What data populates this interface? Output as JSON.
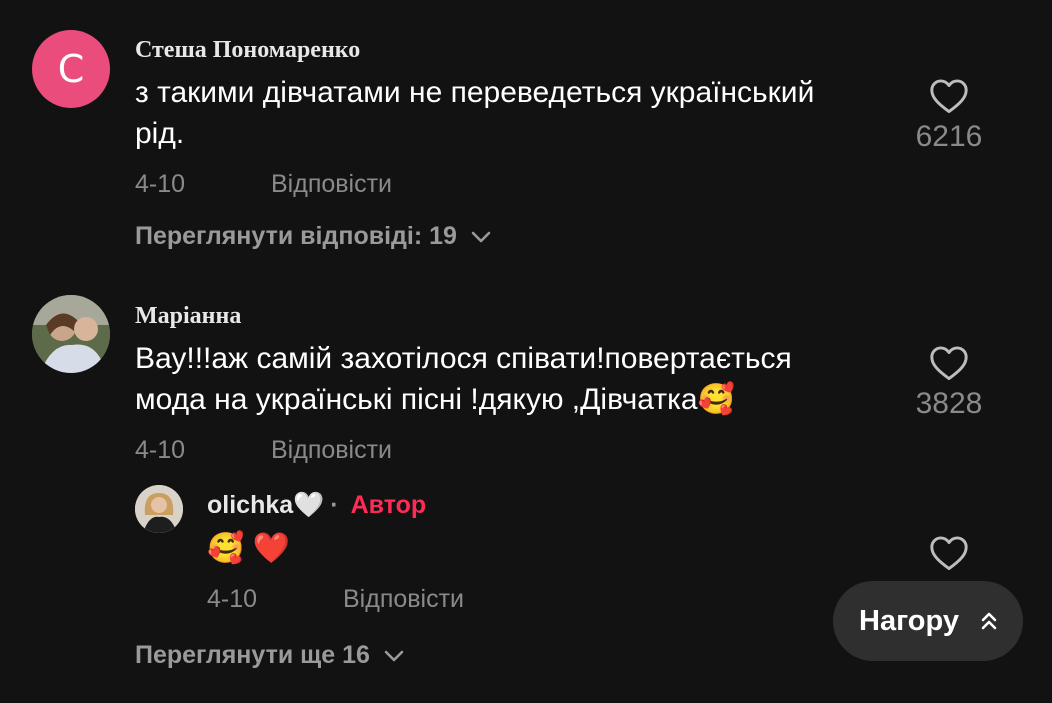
{
  "comments": [
    {
      "username": "Стеша Пономаренко",
      "avatar_letter": "С",
      "text": "з такими дівчатами не переведеться український\nрід.",
      "date": "4-10",
      "reply_label": "Відповісти",
      "likes": "6216",
      "view_replies": "Переглянути відповіді: 19"
    },
    {
      "username": "Маріанна",
      "text": "Вау!!!аж самій захотілося співати!повертається\nмода на українські пісні !дякую ,Дівчатка🥰",
      "date": "4-10",
      "reply_label": "Відповісти",
      "likes": "3828",
      "reply": {
        "username": "olichka🤍",
        "separator": "·",
        "badge": "Автор",
        "text": "🥰 ❤️",
        "date": "4-10",
        "reply_label": "Відповісти"
      },
      "view_more": "Переглянути ще 16"
    }
  ],
  "to_top_label": "Нагору",
  "icons": {
    "like": "heart-outline-icon",
    "expand": "chevron-down-icon",
    "to_top": "double-chevron-up-icon"
  },
  "colors": {
    "background": "#121212",
    "accent": "#fe2c55",
    "avatar": "#ea4c7c"
  }
}
